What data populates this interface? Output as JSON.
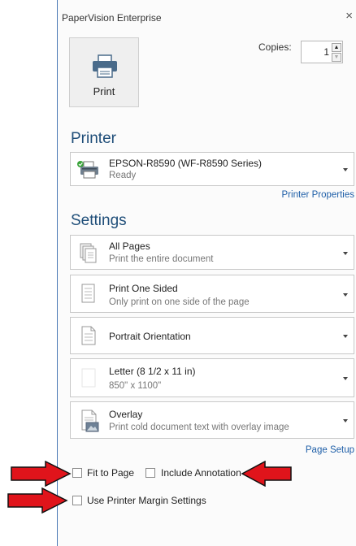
{
  "window": {
    "title": "PaperVision Enterprise",
    "close_glyph": "×"
  },
  "print_button": {
    "label": "Print",
    "icon": "printer-icon"
  },
  "copies": {
    "label": "Copies:",
    "value": "1",
    "up_glyph": "▲",
    "down_glyph": "▼"
  },
  "printer": {
    "heading": "Printer",
    "name": "EPSON-R8590 (WF-R8590 Series)",
    "status": "Ready",
    "properties_link": "Printer Properties"
  },
  "settings": {
    "heading": "Settings",
    "items": [
      {
        "main": "All Pages",
        "sub": "Print the entire document",
        "icon": "pages-icon"
      },
      {
        "main": "Print One Sided",
        "sub": "Only print on one side of the page",
        "icon": "one-sided-icon"
      },
      {
        "main": "Portrait Orientation",
        "sub": "",
        "icon": "portrait-icon"
      },
      {
        "main": "Letter (8 1/2 x 11 in)",
        "sub": "850\" x 1100\"",
        "icon": "paper-size-icon"
      },
      {
        "main": "Overlay",
        "sub": "Print cold document text with overlay image",
        "icon": "overlay-icon"
      }
    ],
    "page_setup_link": "Page Setup"
  },
  "options": {
    "fit_to_page": {
      "label": "Fit to Page",
      "checked": false
    },
    "include_annotation": {
      "label": "Include Annotation",
      "checked": false
    },
    "use_printer_margins": {
      "label": "Use Printer Margin Settings",
      "checked": false
    }
  },
  "colors": {
    "accent": "#1f4e79",
    "link": "#1f5fa8",
    "arrow": "#e0141b"
  }
}
